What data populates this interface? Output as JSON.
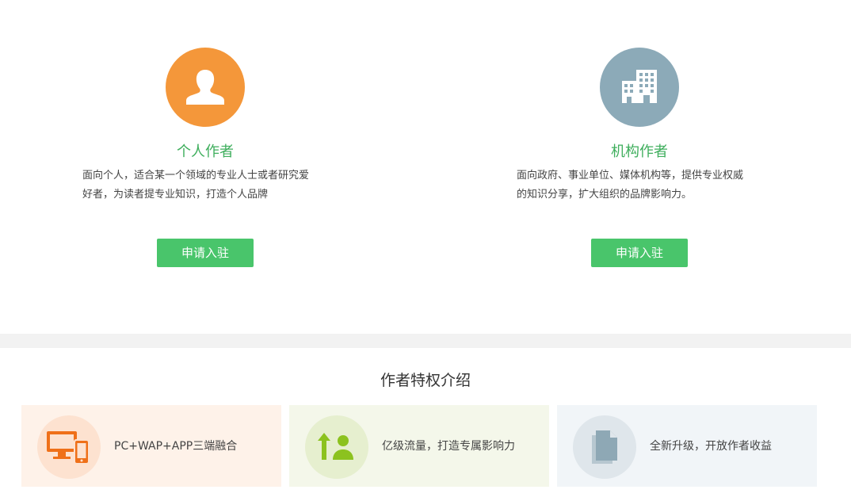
{
  "colors": {
    "green_accent": "#49c56b",
    "green_title": "#3eae5c",
    "orange": "#f4973a",
    "slate": "#8caab8",
    "perk1_bg": "#fef2e9",
    "perk1_circle": "#fde2d0",
    "perk1_icon": "#ef7019",
    "perk2_bg": "#f4f7ea",
    "perk2_circle": "#e6efcf",
    "perk2_icon": "#8cc21f",
    "perk3_bg": "#f1f5f8",
    "perk3_circle": "#dfe6eb",
    "perk3_icon": "#8ea8b5"
  },
  "personal": {
    "icon": "person-icon",
    "title": "个人作者",
    "desc_line1": "面向个人，适合某一个领域的专业人士或者研究爱",
    "desc_line2": "好者，为读者提专业知识，打造个人品牌",
    "button": "申请入驻"
  },
  "org": {
    "icon": "building-icon",
    "title": "机构作者",
    "desc_line1": "面向政府、事业单位、媒体机构等，提供专业权威",
    "desc_line2": "的知识分享，扩大组织的品牌影响力。",
    "button": "申请入驻"
  },
  "privileges": {
    "title": "作者特权介绍",
    "items": [
      {
        "icon": "devices-icon",
        "label": "PC+WAP+APP三端融合"
      },
      {
        "icon": "growth-user-icon",
        "label": "亿级流量，打造专属影响力"
      },
      {
        "icon": "document-icon",
        "label": "全新升级，开放作者收益"
      }
    ]
  }
}
